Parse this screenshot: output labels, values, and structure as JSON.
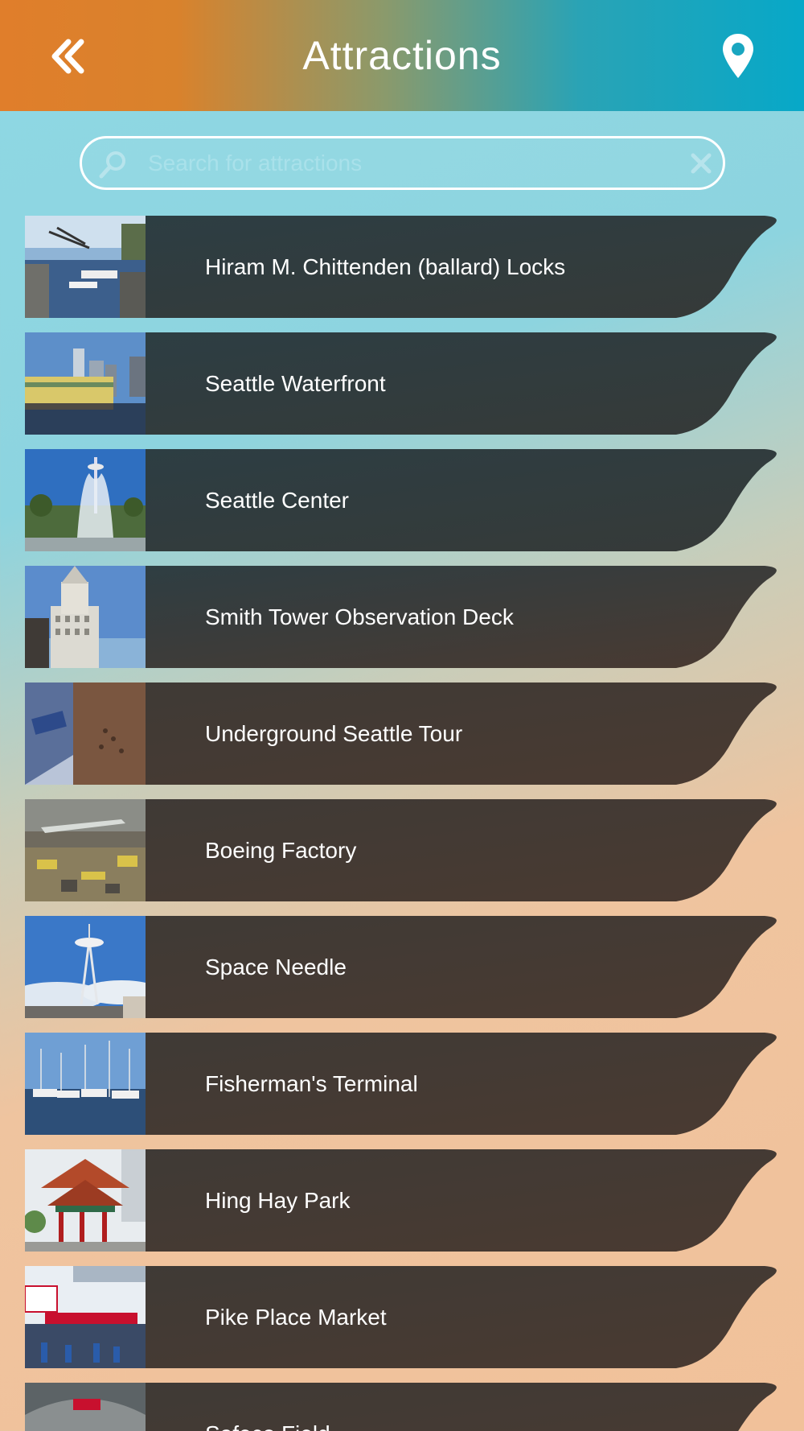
{
  "header": {
    "title": "Attractions",
    "back_icon": "double-chevron-left-icon",
    "map_icon": "map-pin-icon"
  },
  "search": {
    "placeholder": "Search for attractions",
    "value": "",
    "search_icon": "magnifier-icon",
    "clear_icon": "close-icon"
  },
  "colors": {
    "header_left": "#e07e2b",
    "header_right": "#07a8c8",
    "card_teal": "#2c3e44",
    "card_brown": "#4a3a31",
    "text": "#ffffff"
  },
  "attractions": [
    {
      "name": "Hiram M. Chittenden (ballard) Locks",
      "thumb": "locks-canal"
    },
    {
      "name": "Seattle Waterfront",
      "thumb": "waterfront-skyline"
    },
    {
      "name": "Seattle Center",
      "thumb": "fountain-space-needle"
    },
    {
      "name": "Smith Tower Observation Deck",
      "thumb": "smith-tower"
    },
    {
      "name": "Underground Seattle Tour",
      "thumb": "underground-brick"
    },
    {
      "name": "Boeing Factory",
      "thumb": "factory-floor"
    },
    {
      "name": "Space Needle",
      "thumb": "space-needle"
    },
    {
      "name": "Fisherman's Terminal",
      "thumb": "marina-boats"
    },
    {
      "name": "Hing Hay Park",
      "thumb": "pagoda"
    },
    {
      "name": "Pike Place Market",
      "thumb": "market-sign"
    },
    {
      "name": "Safeco Field",
      "thumb": "stadium"
    }
  ]
}
